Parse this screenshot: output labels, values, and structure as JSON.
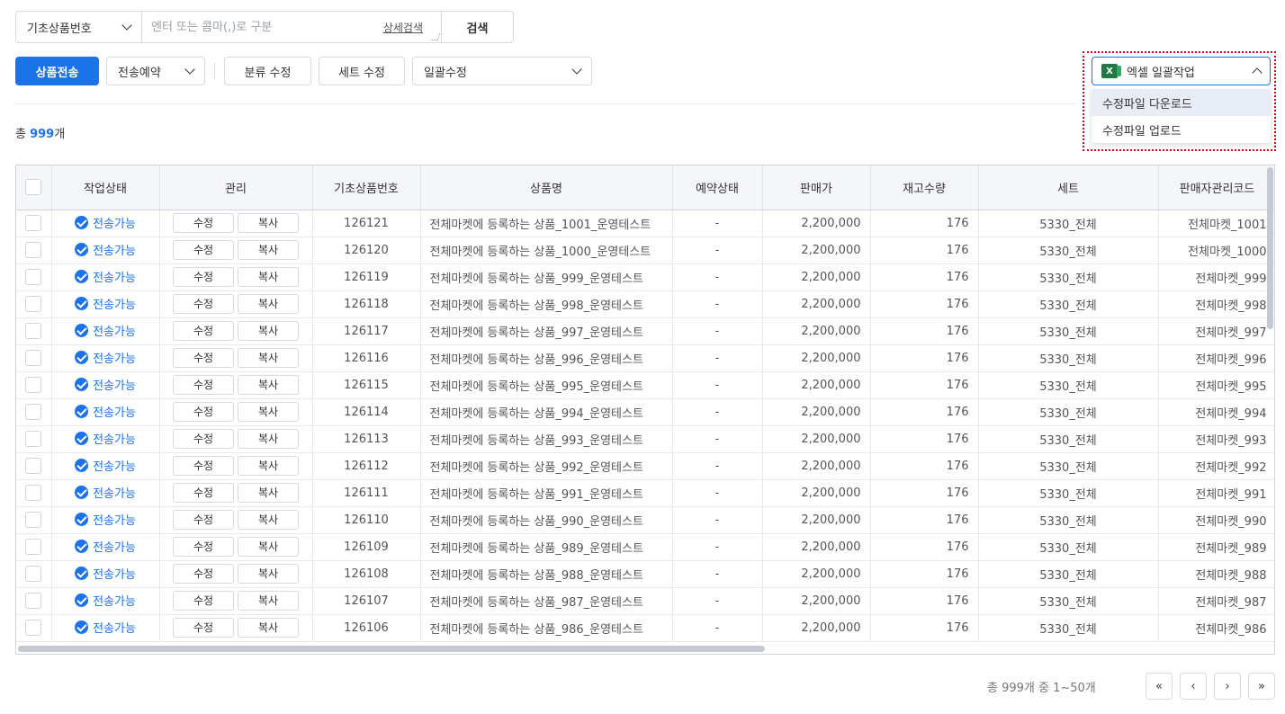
{
  "search": {
    "field_select": "기초상품번호",
    "placeholder": "엔터 또는 콤마(,)로 구분",
    "advanced_link": "상세검색",
    "search_button": "검색"
  },
  "toolbar": {
    "send_button": "상품전송",
    "reserve_select": "전송예약",
    "category_edit": "분류 수정",
    "set_edit": "세트 수정",
    "bulk_edit_select": "일괄수정"
  },
  "excel": {
    "button_label": "엑셀 일괄작업",
    "icon_letter": "X",
    "menu": [
      "수정파일 다운로드",
      "수정파일 업로드"
    ]
  },
  "summary": {
    "prefix": "총 ",
    "count": "999",
    "suffix": "개"
  },
  "table": {
    "headers": [
      "작업상태",
      "관리",
      "기초상품번호",
      "상품명",
      "예약상태",
      "판매가",
      "재고수량",
      "세트",
      "판매자관리코드"
    ],
    "edit_label": "수정",
    "copy_label": "복사",
    "rows": [
      {
        "status": "전송가능",
        "id": "126121",
        "name": "전체마켓에 등록하는 상품_1001_운영테스트",
        "reserve": "-",
        "price": "2,200,000",
        "stock": "176",
        "set": "5330_전체",
        "code": "전체마켓_1001"
      },
      {
        "status": "전송가능",
        "id": "126120",
        "name": "전체마켓에 등록하는 상품_1000_운영테스트",
        "reserve": "-",
        "price": "2,200,000",
        "stock": "176",
        "set": "5330_전체",
        "code": "전체마켓_1000"
      },
      {
        "status": "전송가능",
        "id": "126119",
        "name": "전체마켓에 등록하는 상품_999_운영테스트",
        "reserve": "-",
        "price": "2,200,000",
        "stock": "176",
        "set": "5330_전체",
        "code": "전체마켓_999"
      },
      {
        "status": "전송가능",
        "id": "126118",
        "name": "전체마켓에 등록하는 상품_998_운영테스트",
        "reserve": "-",
        "price": "2,200,000",
        "stock": "176",
        "set": "5330_전체",
        "code": "전체마켓_998"
      },
      {
        "status": "전송가능",
        "id": "126117",
        "name": "전체마켓에 등록하는 상품_997_운영테스트",
        "reserve": "-",
        "price": "2,200,000",
        "stock": "176",
        "set": "5330_전체",
        "code": "전체마켓_997"
      },
      {
        "status": "전송가능",
        "id": "126116",
        "name": "전체마켓에 등록하는 상품_996_운영테스트",
        "reserve": "-",
        "price": "2,200,000",
        "stock": "176",
        "set": "5330_전체",
        "code": "전체마켓_996"
      },
      {
        "status": "전송가능",
        "id": "126115",
        "name": "전체마켓에 등록하는 상품_995_운영테스트",
        "reserve": "-",
        "price": "2,200,000",
        "stock": "176",
        "set": "5330_전체",
        "code": "전체마켓_995"
      },
      {
        "status": "전송가능",
        "id": "126114",
        "name": "전체마켓에 등록하는 상품_994_운영테스트",
        "reserve": "-",
        "price": "2,200,000",
        "stock": "176",
        "set": "5330_전체",
        "code": "전체마켓_994"
      },
      {
        "status": "전송가능",
        "id": "126113",
        "name": "전체마켓에 등록하는 상품_993_운영테스트",
        "reserve": "-",
        "price": "2,200,000",
        "stock": "176",
        "set": "5330_전체",
        "code": "전체마켓_993"
      },
      {
        "status": "전송가능",
        "id": "126112",
        "name": "전체마켓에 등록하는 상품_992_운영테스트",
        "reserve": "-",
        "price": "2,200,000",
        "stock": "176",
        "set": "5330_전체",
        "code": "전체마켓_992"
      },
      {
        "status": "전송가능",
        "id": "126111",
        "name": "전체마켓에 등록하는 상품_991_운영테스트",
        "reserve": "-",
        "price": "2,200,000",
        "stock": "176",
        "set": "5330_전체",
        "code": "전체마켓_991"
      },
      {
        "status": "전송가능",
        "id": "126110",
        "name": "전체마켓에 등록하는 상품_990_운영테스트",
        "reserve": "-",
        "price": "2,200,000",
        "stock": "176",
        "set": "5330_전체",
        "code": "전체마켓_990"
      },
      {
        "status": "전송가능",
        "id": "126109",
        "name": "전체마켓에 등록하는 상품_989_운영테스트",
        "reserve": "-",
        "price": "2,200,000",
        "stock": "176",
        "set": "5330_전체",
        "code": "전체마켓_989"
      },
      {
        "status": "전송가능",
        "id": "126108",
        "name": "전체마켓에 등록하는 상품_988_운영테스트",
        "reserve": "-",
        "price": "2,200,000",
        "stock": "176",
        "set": "5330_전체",
        "code": "전체마켓_988"
      },
      {
        "status": "전송가능",
        "id": "126107",
        "name": "전체마켓에 등록하는 상품_987_운영테스트",
        "reserve": "-",
        "price": "2,200,000",
        "stock": "176",
        "set": "5330_전체",
        "code": "전체마켓_987"
      },
      {
        "status": "전송가능",
        "id": "126106",
        "name": "전체마켓에 등록하는 상품_986_운영테스트",
        "reserve": "-",
        "price": "2,200,000",
        "stock": "176",
        "set": "5330_전체",
        "code": "전체마켓_986"
      }
    ]
  },
  "pagination": {
    "info": "총 999개 중 1~50개",
    "first": "«",
    "prev": "‹",
    "next": "›",
    "last": "»"
  },
  "colors": {
    "primary": "#1a73e8",
    "highlight_border": "#e0001a",
    "excel_green": "#1e7a43"
  }
}
